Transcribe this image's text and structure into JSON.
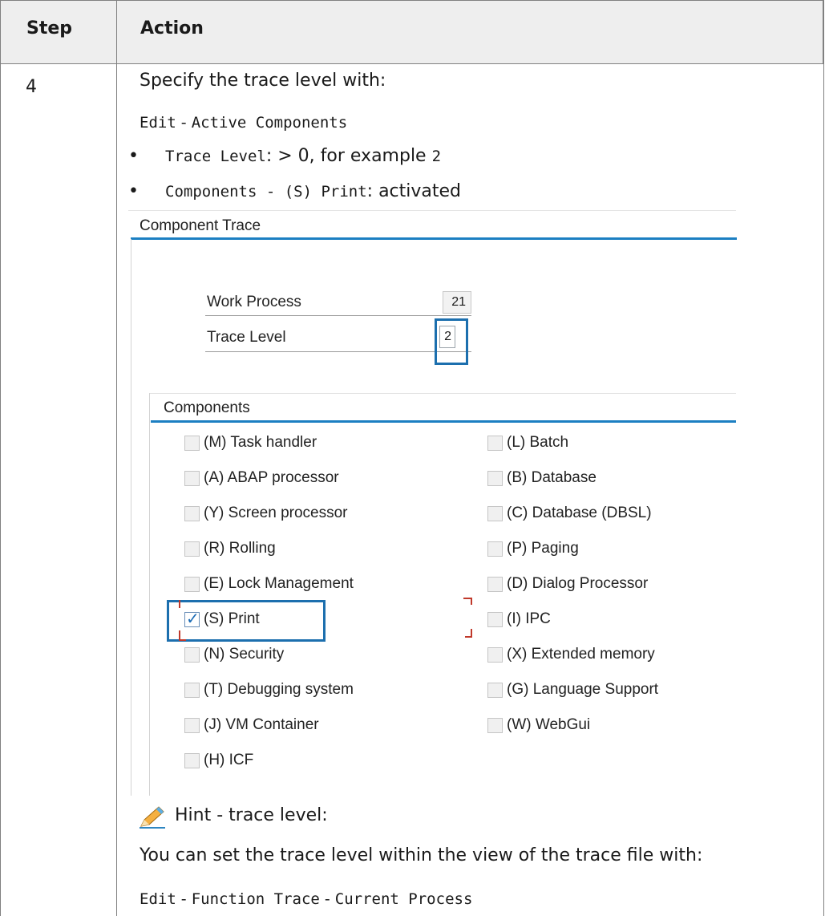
{
  "header": {
    "step": "Step",
    "action": "Action"
  },
  "row": {
    "step_number": "4",
    "intro": "Specify the trace level with:",
    "menu_path": {
      "a": "Edit",
      "sep": " - ",
      "b": "Active Components"
    },
    "bullets": [
      {
        "code": "Trace Level",
        "text": ": > 0, for example ",
        "code2": "2"
      },
      {
        "code": "Components - (S) Print",
        "text": ": activated"
      }
    ],
    "hint_title": "Hint - trace level:",
    "hint_text": "You can set the trace level within the view of the trace file with:",
    "hint_path": {
      "a": "Edit",
      "sep1": " - ",
      "b": "Function Trace",
      "sep2": " - ",
      "c": "Current Process"
    }
  },
  "sap": {
    "section_title": "Component Trace",
    "work_process_label": "Work Process",
    "work_process_value": "21",
    "trace_level_label": "Trace Level",
    "trace_level_value": "2",
    "components_title": "Components",
    "left_column": [
      {
        "label": "(M) Task handler",
        "checked": false
      },
      {
        "label": "(A) ABAP processor",
        "checked": false
      },
      {
        "label": "(Y) Screen processor",
        "checked": false
      },
      {
        "label": "(R) Rolling",
        "checked": false
      },
      {
        "label": "(E) Lock Management",
        "checked": false
      },
      {
        "label": "(S) Print",
        "checked": true
      },
      {
        "label": "(N) Security",
        "checked": false
      },
      {
        "label": "(T) Debugging system",
        "checked": false
      },
      {
        "label": "(J) VM Container",
        "checked": false
      },
      {
        "label": "(H) ICF",
        "checked": false
      }
    ],
    "right_column": [
      {
        "label": "(L) Batch",
        "checked": false
      },
      {
        "label": "(B) Database",
        "checked": false
      },
      {
        "label": "(C) Database (DBSL)",
        "checked": false
      },
      {
        "label": "(P) Paging",
        "checked": false
      },
      {
        "label": "(D) Dialog Processor",
        "checked": false
      },
      {
        "label": "(I) IPC",
        "checked": false
      },
      {
        "label": "(X) Extended memory",
        "checked": false
      },
      {
        "label": "(G) Language Support",
        "checked": false
      },
      {
        "label": "(W) WebGui",
        "checked": false
      }
    ]
  },
  "colors": {
    "accent": "#1c7fc2",
    "highlight": "#1c6fae",
    "marker": "#c0392b",
    "pencil": "#f0a020"
  }
}
